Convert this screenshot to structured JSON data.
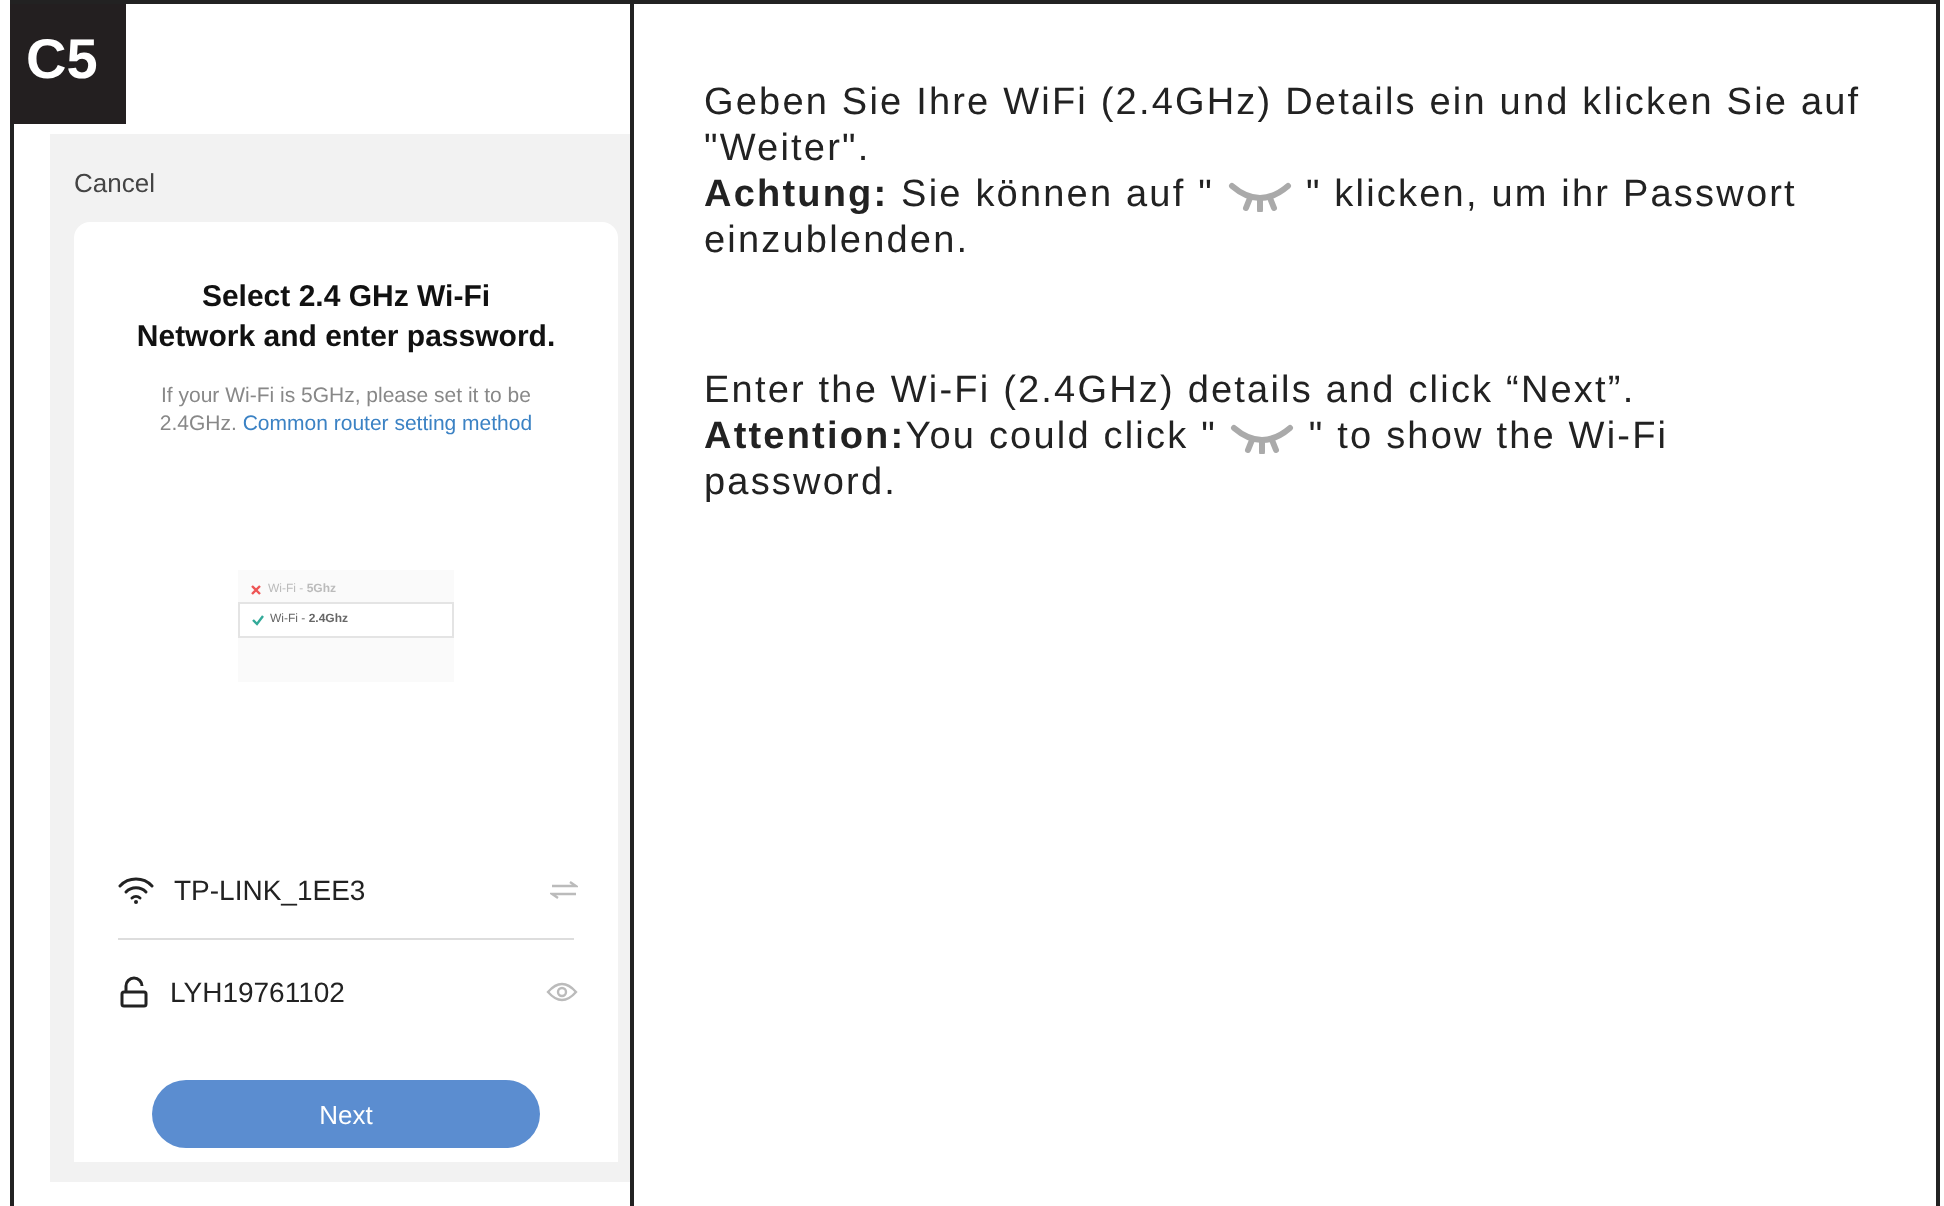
{
  "step_badge": "C5",
  "phone": {
    "cancel": "Cancel",
    "title": [
      "Select 2.4 GHz Wi-Fi",
      "Network and enter password."
    ],
    "hint": "If your Wi-Fi is 5GHz, please set it to be 2.4GHz.",
    "hint_link": "Common router setting method",
    "networks": [
      {
        "name": "Wi-Fi - **5Ghz**",
        "supported": false
      },
      {
        "name": "Wi-Fi - **2.4Ghz**",
        "supported": true
      }
    ],
    "ssid": "TP-LINK_1EE3",
    "password": "LYH19761102",
    "next_button": "Next"
  },
  "instructions": [
    {
      "kind": "plain",
      "text": "Geben Sie Ihre WiFi (2.4GHz) Details ein und klicken Sie auf \"Weiter\"."
    },
    {
      "kind": "icon",
      "before": "**Achtung:** Sie können auf \"",
      "after": "\" klicken, um ihr Passwort",
      "continuation": "einzublenden."
    },
    {
      "kind": "gap"
    },
    {
      "kind": "plain",
      "text": "Enter the Wi-Fi (2.4GHz) details and click “Next”."
    },
    {
      "kind": "icon",
      "before": "**Attention:**You could click \"",
      "after": "\" to show the Wi-Fi",
      "continuation": "password."
    }
  ]
}
